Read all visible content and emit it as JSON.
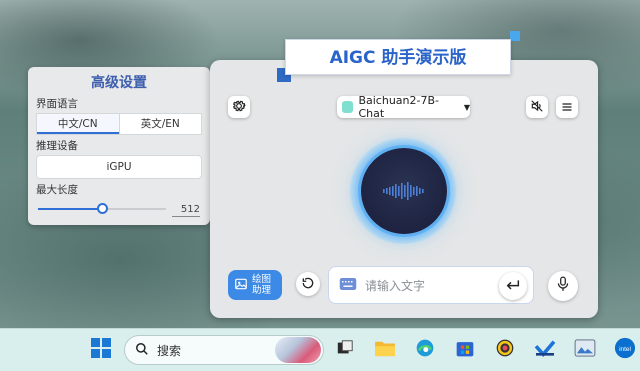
{
  "banner": {
    "title": "AIGC 助手演示版"
  },
  "settings": {
    "title": "高级设置",
    "language_label": "界面语言",
    "language_options": [
      "中文/CN",
      "英文/EN"
    ],
    "language_selected": "中文/CN",
    "device_label": "推理设备",
    "device_value": "iGPU",
    "max_length_label": "最大长度",
    "max_length_value": "512",
    "max_length_fraction": 0.5
  },
  "main": {
    "settings_icon": "gear-icon",
    "model_name": "Baichuan2-7B-Chat",
    "mute_icon": "speaker-mute-icon",
    "menu_icon": "hamburger-menu-icon",
    "draw_assistant_label": "绘图助理",
    "input_placeholder": "请输入文字",
    "keyboard_icon": "keyboard-icon",
    "enter_icon": "enter-icon",
    "mic_icon": "microphone-icon",
    "refresh_icon": "refresh-icon"
  },
  "taskbar": {
    "search_placeholder": "搜索",
    "apps": [
      "windows-start-icon",
      "task-view-icon",
      "file-explorer-icon",
      "edge-icon",
      "store-icon",
      "color-app-icon",
      "app-icon",
      "image-viewer-icon",
      "intel-icon"
    ]
  },
  "colors": {
    "accent": "#2f6fd6",
    "brand_blue": "#2a63c9",
    "draw_button": "#3c8ae5"
  }
}
